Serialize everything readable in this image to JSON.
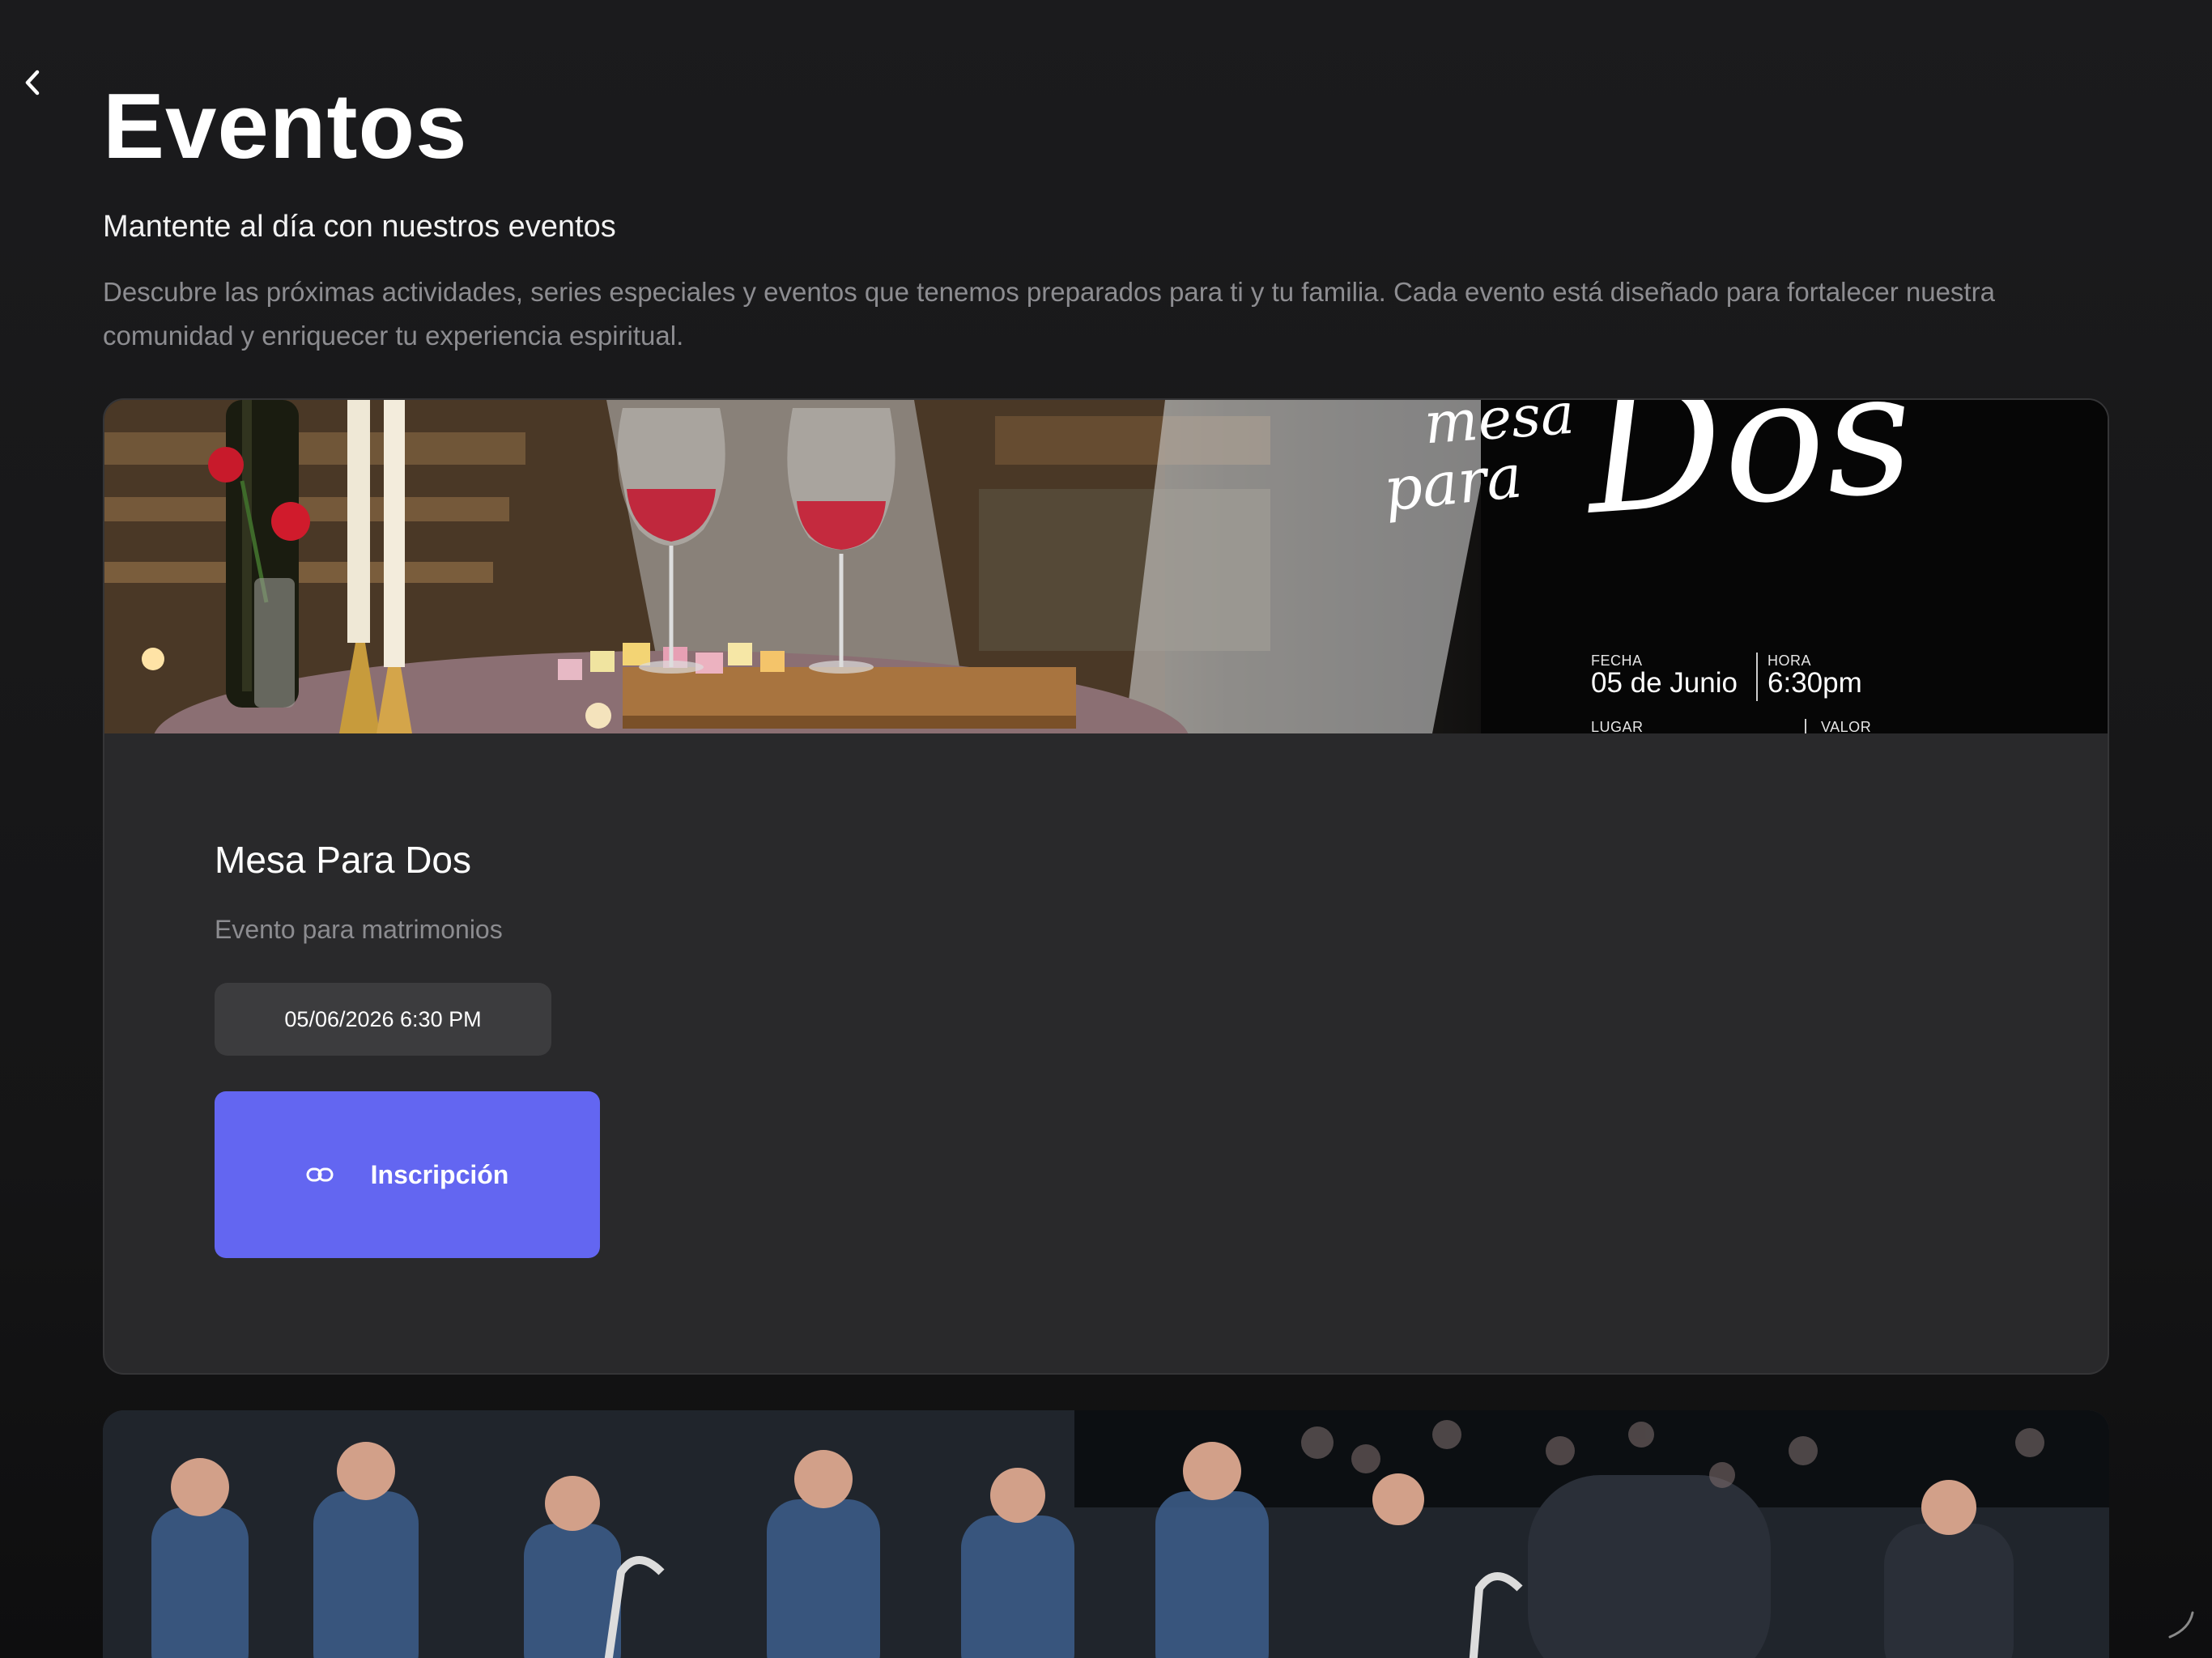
{
  "header": {
    "title": "Eventos",
    "subtitle": "Mantente al día con nuestros eventos",
    "description": "Descubre las próximas actividades, series especiales y eventos que tenemos preparados para ti y tu familia. Cada evento está diseñado para fortalecer nuestra comunidad y enriquecer tu experiencia espiritual."
  },
  "events": [
    {
      "banner": {
        "script_small_1": "mesa",
        "script_small_2": "para",
        "script_large": "Dos",
        "fecha_label": "FECHA",
        "fecha_value": "05 de Junio",
        "hora_label": "HORA",
        "hora_value": "6:30pm",
        "lugar_label": "LUGAR",
        "valor_label": "VALOR"
      },
      "name": "Mesa Para Dos",
      "subtitle": "Evento para matrimonios",
      "datetime": "05/06/2026 6:30 PM",
      "button_label": "Inscripción"
    }
  ],
  "icons": {
    "back": "chevron-left-icon",
    "link": "link-icon"
  },
  "colors": {
    "background": "#19191b",
    "card": "#29292b",
    "chip": "#3c3c3e",
    "accent": "#6366f1"
  }
}
